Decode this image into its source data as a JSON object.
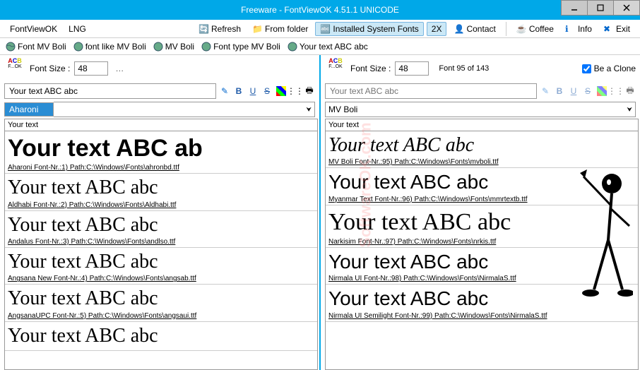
{
  "titlebar": {
    "text": "Freeware - FontViewOK 4.51.1 UNICODE"
  },
  "menubar": {
    "app": "FontViewOK",
    "lng": "LNG",
    "refresh": "Refresh",
    "from_folder": "From folder",
    "installed": "Installed System Fonts",
    "tx": "2X",
    "contact": "Contact",
    "coffee": "Coffee",
    "info": "Info",
    "exit": "Exit"
  },
  "searchbar": {
    "items": [
      "Font MV Boli",
      "font like MV Boli",
      "MV Boli",
      "Font type MV Boli",
      "Your text ABC abc"
    ]
  },
  "left": {
    "size_label": "Font Size :",
    "size_value": "48",
    "sample_text": "Your text ABC abc",
    "selected_font": "Aharoni",
    "list_header": "Your text",
    "fonts": [
      {
        "sample": "Your text ABC ab",
        "info": "Aharoni Font-Nr.:1) Path:C:\\Windows\\Fonts\\ahronbd.ttf",
        "cls": "sample-bold"
      },
      {
        "sample": "Your text ABC abc",
        "info": "Aldhabi Font-Nr.:2) Path:C:\\Windows\\Fonts\\Aldhabi.ttf",
        "cls": "sample-serif"
      },
      {
        "sample": "Your text ABC abc",
        "info": "Andalus Font-Nr.:3) Path:C:\\Windows\\Fonts\\andlso.ttf",
        "cls": "sample-serif"
      },
      {
        "sample": "Your text ABC abc",
        "info": "Angsana New Font-Nr.:4) Path:C:\\Windows\\Fonts\\angsab.ttf",
        "cls": "sample-serif"
      },
      {
        "sample": "Your text ABC abc",
        "info": "AngsanaUPC Font-Nr.:5) Path:C:\\Windows\\Fonts\\angsaui.ttf",
        "cls": "sample-serif"
      },
      {
        "sample": "Your text ABC abc",
        "info": "",
        "cls": "sample-serif"
      }
    ]
  },
  "right": {
    "size_label": "Font Size :",
    "size_value": "48",
    "font_count": "Font 95 of 143",
    "clone_label": "Be a Clone",
    "sample_placeholder": "Your text ABC abc",
    "selected_font": "MV Boli",
    "list_header": "Your text",
    "fonts": [
      {
        "sample": "Your text ABC abc",
        "info": "MV Boli Font-Nr.:95) Path:C:\\Windows\\Fonts\\mvboli.ttf",
        "cls": "sample-script"
      },
      {
        "sample": "Your text ABC abc",
        "info": "Myanmar Text Font-Nr.:96) Path:C:\\Windows\\Fonts\\mmrtextb.ttf",
        "cls": "sample-sans"
      },
      {
        "sample": "Your text ABC abc",
        "info": "Narkisim Font-Nr.:97) Path:C:\\Windows\\Fonts\\nrkis.ttf",
        "cls": "sample-serif",
        "big": true
      },
      {
        "sample": "Your text ABC abc",
        "info": "Nirmala UI Font-Nr.:98) Path:C:\\Windows\\Fonts\\NirmalaS.ttf",
        "cls": "sample-sans"
      },
      {
        "sample": "Your text ABC abc",
        "info": "Nirmala UI Semilight Font-Nr.:99) Path:C:\\Windows\\Fonts\\NirmalaS.ttf",
        "cls": "sample-sans"
      }
    ]
  },
  "watermark": "SoftwareOK.com"
}
